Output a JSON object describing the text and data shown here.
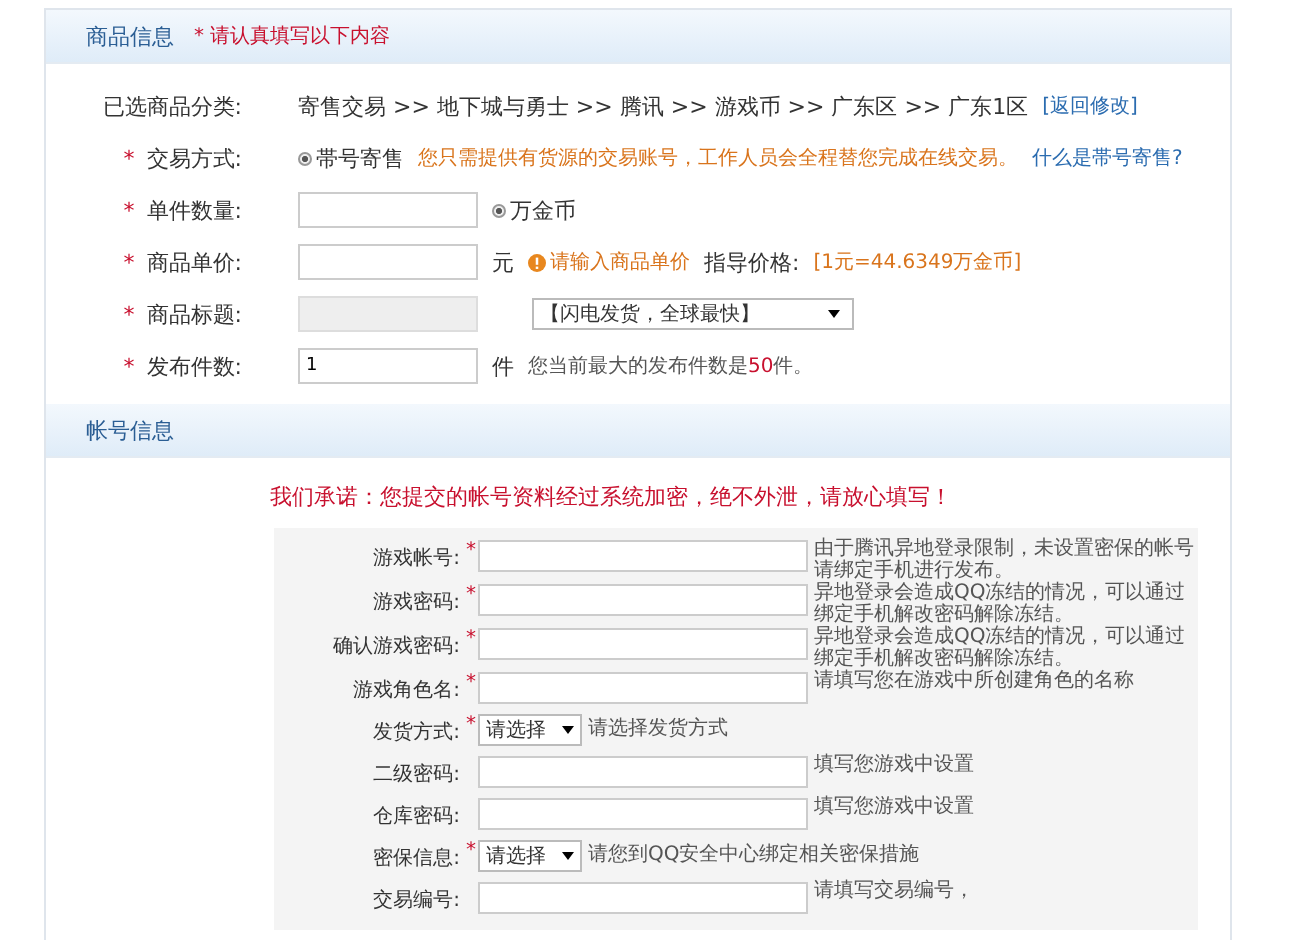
{
  "sections": [
    {
      "title": "商品信息",
      "note": "* 请认真填写以下内容",
      "rows": [
        {
          "label": "已选商品分类:",
          "controls": [
            {
              "kind": "text",
              "text": "寄售交易 >> 地下城与勇士 >> 腾讯 >> 游戏币 >> 广东区 >> 广东1区"
            },
            {
              "kind": "link",
              "text": "[返回修改]"
            }
          ]
        },
        {
          "required_mark": "*",
          "label": "交易方式:",
          "controls": [
            {
              "kind": "radio",
              "label": "帯号寄售",
              "selected": true
            },
            {
              "kind": "warning",
              "text": "您只需提供有货源的交易账号，工作人员会全程替您完成在线交易。"
            },
            {
              "kind": "link",
              "text": "什么是帯号寄售?"
            }
          ]
        },
        {
          "required_mark": "*",
          "label": "单件数量:",
          "controls": [
            {
              "kind": "input",
              "disabled": false
            },
            {
              "kind": "radio",
              "label": "万金币",
              "selected": true
            }
          ]
        },
        {
          "required_mark": "*",
          "label": "商品单价:",
          "controls": [
            {
              "kind": "input",
              "disabled": false
            },
            {
              "kind": "text",
              "text": "元"
            },
            {
              "kind": "alert",
              "text": "请输入商品单价"
            },
            {
              "kind": "text",
              "text": "指导价格:"
            },
            {
              "kind": "warning",
              "text": "[1元=44.6349万金币]"
            }
          ]
        },
        {
          "required_mark": "*",
          "label": "商品标题:",
          "controls": [
            {
              "kind": "input",
              "disabled": true
            },
            {
              "kind": "select",
              "value": "【闪电发货，全球最快】"
            }
          ]
        },
        {
          "required_mark": "*",
          "label": "发布件数:",
          "controls": [
            {
              "kind": "input",
              "value": "1",
              "disabled": false
            },
            {
              "kind": "text",
              "text": "件"
            },
            {
              "kind": "hint",
              "text": "您当前最大的发布件数是**50**件。"
            }
          ]
        }
      ]
    },
    {
      "title": "帐号信息",
      "promise": "我们承诺：您提交的帐号资料经过系统加密，绝不外泄，请放心填写！",
      "fields": [
        {
          "label": "游戏帐号:",
          "required_mark": "*",
          "kind": "input",
          "hint": "由于腾讯异地登录限制，未设置密保的帐号请绑定手机进行发布。"
        },
        {
          "label": "游戏密码:",
          "required_mark": "*",
          "kind": "input",
          "hint": "异地登录会造成QQ冻结的情况，可以通过绑定手机解改密码解除冻结。"
        },
        {
          "label": "确认游戏密码:",
          "required_mark": "*",
          "kind": "input",
          "hint": "异地登录会造成QQ冻结的情况，可以通过绑定手机解改密码解除冻结。"
        },
        {
          "label": "游戏角色名:",
          "required_mark": "*",
          "kind": "input",
          "hint": "请填写您在游戏中所创建角色的名称"
        },
        {
          "label": "发货方式:",
          "required_mark": "*",
          "kind": "select",
          "value": "请选择",
          "hint": "请选择发货方式"
        },
        {
          "label": "二级密码:",
          "kind": "input",
          "hint": "填写您游戏中设置"
        },
        {
          "label": "仓库密码:",
          "kind": "input",
          "hint": "填写您游戏中设置"
        },
        {
          "label": "密保信息:",
          "required_mark": "*",
          "kind": "select",
          "value": "请选择",
          "hint": "请您到QQ安全中心绑定相关密保措施"
        },
        {
          "label": "交易编号:",
          "kind": "input",
          "hint": "请填写交易编号，"
        }
      ]
    }
  ]
}
